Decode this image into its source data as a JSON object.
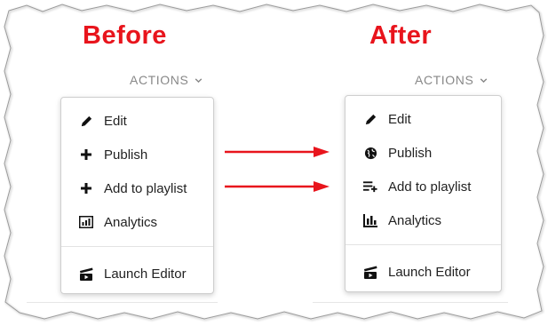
{
  "before": {
    "title": "Before",
    "actions_label": "ACTIONS",
    "items": [
      {
        "label": "Edit",
        "icon": "pencil-icon"
      },
      {
        "label": "Publish",
        "icon": "plus-icon"
      },
      {
        "label": "Add to playlist",
        "icon": "plus-icon"
      },
      {
        "label": "Analytics",
        "icon": "analytics-icon"
      },
      {
        "label": "Launch Editor",
        "icon": "clapperboard-icon"
      }
    ]
  },
  "after": {
    "title": "After",
    "actions_label": "ACTIONS",
    "items": [
      {
        "label": "Edit",
        "icon": "pencil-icon"
      },
      {
        "label": "Publish",
        "icon": "globe-icon"
      },
      {
        "label": "Add to playlist",
        "icon": "playlist-add-icon"
      },
      {
        "label": "Analytics",
        "icon": "bar-chart-icon"
      },
      {
        "label": "Launch Editor",
        "icon": "clapperboard-icon"
      }
    ]
  },
  "colors": {
    "heading": "#e8141c",
    "arrow": "#e8141c",
    "text": "#222222",
    "muted": "#888888"
  }
}
